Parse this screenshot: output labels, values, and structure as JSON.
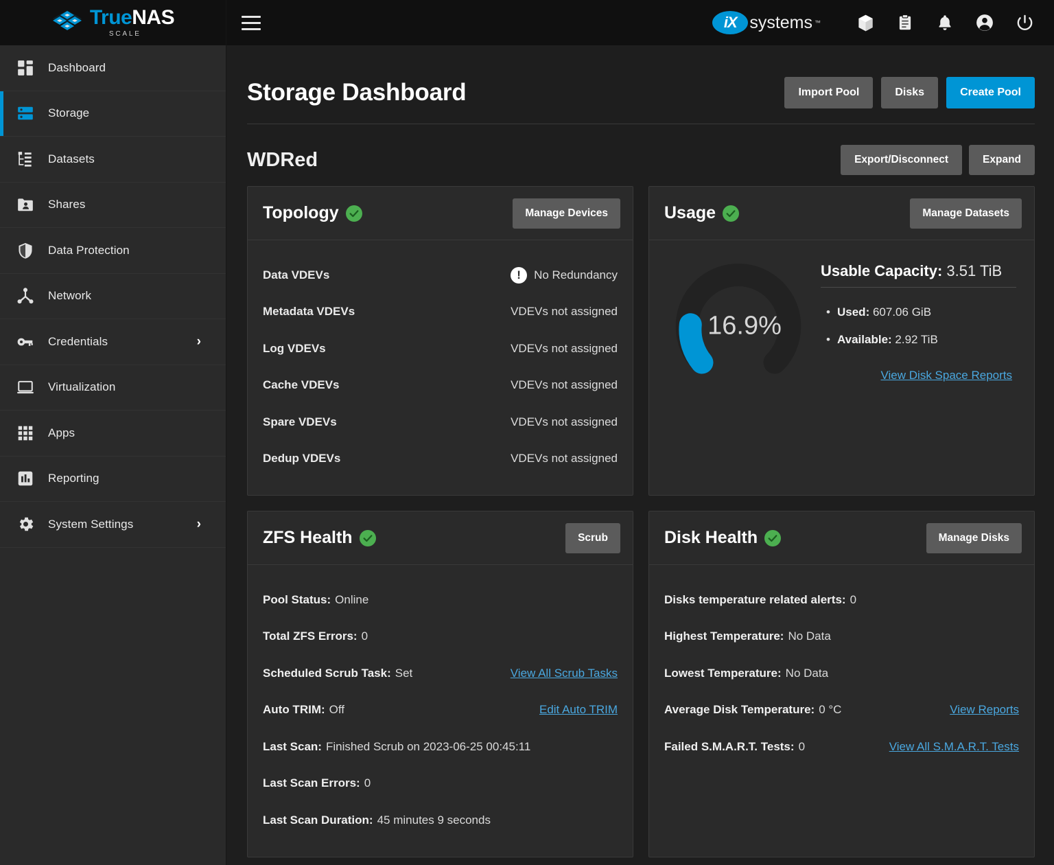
{
  "brand": {
    "title_part1": "True",
    "title_part2": "NAS",
    "subtitle": "SCALE",
    "logo_icon": "truenas-cube-logo"
  },
  "sidebar": {
    "items": [
      {
        "label": "Dashboard",
        "icon": "dashboard-grid-icon",
        "active": false,
        "expandable": false
      },
      {
        "label": "Storage",
        "icon": "storage-server-icon",
        "active": true,
        "expandable": false
      },
      {
        "label": "Datasets",
        "icon": "datasets-tree-icon",
        "active": false,
        "expandable": false
      },
      {
        "label": "Shares",
        "icon": "shares-folder-user-icon",
        "active": false,
        "expandable": false
      },
      {
        "label": "Data Protection",
        "icon": "shield-icon",
        "active": false,
        "expandable": false
      },
      {
        "label": "Network",
        "icon": "network-nodes-icon",
        "active": false,
        "expandable": false
      },
      {
        "label": "Credentials",
        "icon": "key-icon",
        "active": false,
        "expandable": true
      },
      {
        "label": "Virtualization",
        "icon": "laptop-icon",
        "active": false,
        "expandable": false
      },
      {
        "label": "Apps",
        "icon": "apps-grid-icon",
        "active": false,
        "expandable": false
      },
      {
        "label": "Reporting",
        "icon": "bar-chart-icon",
        "active": false,
        "expandable": false
      },
      {
        "label": "System Settings",
        "icon": "gear-icon",
        "active": false,
        "expandable": true
      }
    ],
    "chevron_glyph": "›"
  },
  "topbar": {
    "menu_icon": "hamburger-menu-icon",
    "ix_logo": {
      "mark": "iX",
      "word": "systems",
      "tm": "™"
    },
    "icons": [
      {
        "name": "cube-icon"
      },
      {
        "name": "clipboard-icon"
      },
      {
        "name": "bell-icon"
      },
      {
        "name": "account-circle-icon"
      },
      {
        "name": "power-icon"
      }
    ]
  },
  "page": {
    "title": "Storage Dashboard",
    "actions": [
      {
        "label": "Import Pool",
        "style": "secondary"
      },
      {
        "label": "Disks",
        "style": "secondary"
      },
      {
        "label": "Create Pool",
        "style": "primary"
      }
    ]
  },
  "pool": {
    "name": "WDRed",
    "actions": [
      {
        "label": "Export/Disconnect"
      },
      {
        "label": "Expand"
      }
    ]
  },
  "topology": {
    "title": "Topology",
    "status_icon": "check-circle-icon",
    "action_label": "Manage Devices",
    "rows": [
      {
        "label": "Data VDEVs",
        "value": "No Redundancy",
        "icon": "warning-exclamation-icon"
      },
      {
        "label": "Metadata VDEVs",
        "value": "VDEVs not assigned",
        "icon": ""
      },
      {
        "label": "Log VDEVs",
        "value": "VDEVs not assigned",
        "icon": ""
      },
      {
        "label": "Cache VDEVs",
        "value": "VDEVs not assigned",
        "icon": ""
      },
      {
        "label": "Spare VDEVs",
        "value": "VDEVs not assigned",
        "icon": ""
      },
      {
        "label": "Dedup VDEVs",
        "value": "VDEVs not assigned",
        "icon": ""
      }
    ]
  },
  "usage": {
    "title": "Usage",
    "status_icon": "check-circle-icon",
    "action_label": "Manage Datasets",
    "gauge_percent_label": "16.9%",
    "gauge_percent_value": 16.9,
    "usable_capacity_label": "Usable Capacity:",
    "usable_capacity_value": "3.51 TiB",
    "used_label": "Used:",
    "used_value": "607.06 GiB",
    "available_label": "Available:",
    "available_value": "2.92 TiB",
    "reports_link": "View Disk Space Reports",
    "gauge_color": "#0095d5",
    "gauge_track_color": "#222222"
  },
  "zfs_health": {
    "title": "ZFS Health",
    "status_icon": "check-circle-icon",
    "action_label": "Scrub",
    "rows": [
      {
        "label": "Pool Status:",
        "value": "Online",
        "link": ""
      },
      {
        "label": "Total ZFS Errors:",
        "value": "0",
        "link": ""
      },
      {
        "label": "Scheduled Scrub Task:",
        "value": "Set",
        "link": "View All Scrub Tasks"
      },
      {
        "label": "Auto TRIM:",
        "value": "Off",
        "link": "Edit Auto TRIM"
      },
      {
        "label": "Last Scan:",
        "value": "Finished Scrub on 2023-06-25 00:45:11",
        "link": ""
      },
      {
        "label": "Last Scan Errors:",
        "value": "0",
        "link": ""
      },
      {
        "label": "Last Scan Duration:",
        "value": "45 minutes 9 seconds",
        "link": ""
      }
    ]
  },
  "disk_health": {
    "title": "Disk Health",
    "status_icon": "check-circle-icon",
    "action_label": "Manage Disks",
    "rows": [
      {
        "label": "Disks temperature related alerts:",
        "value": "0",
        "link": ""
      },
      {
        "label": "Highest Temperature:",
        "value": "No Data",
        "link": ""
      },
      {
        "label": "Lowest Temperature:",
        "value": "No Data",
        "link": ""
      },
      {
        "label": "Average Disk Temperature:",
        "value": "0 °C",
        "link": "View Reports"
      },
      {
        "label": "Failed S.M.A.R.T. Tests:",
        "value": "0",
        "link": "View All S.M.A.R.T. Tests"
      }
    ]
  },
  "colors": {
    "accent": "#0095d5",
    "ok_green": "#4caf50",
    "link": "#4aa8e0",
    "card_bg": "#2a2a2a",
    "page_bg": "#1e1e1e",
    "topbar_bg": "#101010"
  }
}
